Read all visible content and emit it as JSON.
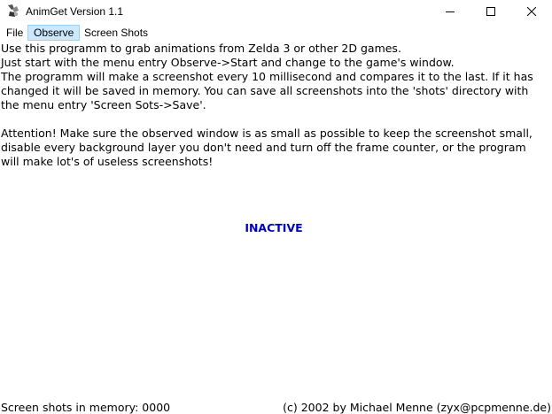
{
  "window": {
    "title": "AnimGet Version 1.1",
    "icon": "animget-app-icon",
    "controls": {
      "minimize_icon": "minimize-icon",
      "maximize_icon": "maximize-icon",
      "close_icon": "close-icon"
    }
  },
  "menubar": {
    "items": [
      {
        "label": "File",
        "active": false
      },
      {
        "label": "Observe",
        "active": true
      },
      {
        "label": "Screen Shots",
        "active": false
      }
    ]
  },
  "instructions": {
    "lines": [
      "Use this programm to grab animations from Zelda 3 or other 2D games.",
      "Just start with the menu entry Observe->Start and change to the game's window.",
      "The programm will make a screenshot every 10 millisecond and compares it to the last. If it has",
      "changed it will be saved in memory. You can save all screenshots into the 'shots' directory with",
      "the menu entry 'Screen Sots->Save'.",
      "",
      "Attention! Make sure the observed window is as small as possible to keep the screenshot small,",
      "disable every background layer you don't need and turn off the frame counter, or the program",
      "will make lot's of useless screenshots!"
    ]
  },
  "status": {
    "state": "INACTIVE",
    "state_color": "#0000c0",
    "memory_label": "Screen shots in memory: 0000",
    "copyright": "(c) 2002 by Michael Menne (zyx@pcpmenne.de)"
  },
  "colors": {
    "menu_highlight": "#cce8ff",
    "menu_highlight_border": "#99d1ff"
  }
}
